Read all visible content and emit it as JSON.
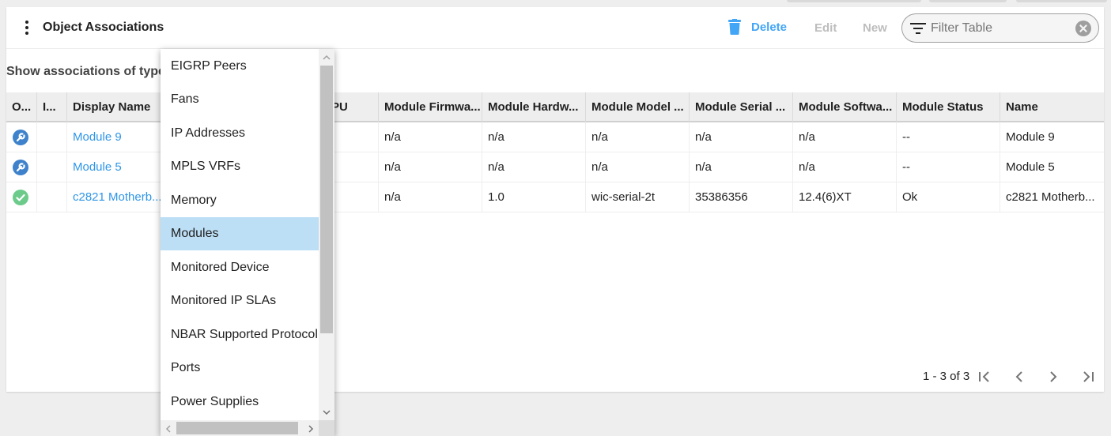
{
  "panel": {
    "title": "Object Associations"
  },
  "toolbar": {
    "delete_label": "Delete",
    "edit_label": "Edit",
    "new_label": "New",
    "filter_placeholder": "Filter Table"
  },
  "association": {
    "label": "Show associations of type:",
    "options": [
      "EIGRP Peers",
      "Fans",
      "IP Addresses",
      "MPLS VRFs",
      "Memory",
      "Modules",
      "Monitored Device",
      "Monitored IP SLAs",
      "NBAR Supported Protocol",
      "Ports",
      "Power Supplies"
    ],
    "selected": "Modules"
  },
  "table": {
    "columns": [
      "O...",
      "I...",
      "Display Name",
      "PU",
      "Module Firmwa...",
      "Module Hardw...",
      "Module Model ...",
      "Module Serial ...",
      "Module Softwa...",
      "Module Status",
      "Name"
    ],
    "rows": [
      {
        "status_icon": "wrench-icon",
        "display_name": "Module 9",
        "firmware": "n/a",
        "hardware": "n/a",
        "model": "n/a",
        "serial": "n/a",
        "software": "n/a",
        "status": "--",
        "name": "Module 9"
      },
      {
        "status_icon": "wrench-icon",
        "display_name": "Module 5",
        "firmware": "n/a",
        "hardware": "n/a",
        "model": "n/a",
        "serial": "n/a",
        "software": "n/a",
        "status": "--",
        "name": "Module 5"
      },
      {
        "status_icon": "check-icon",
        "display_name": "c2821 Motherb...",
        "firmware": "n/a",
        "hardware": "1.0",
        "model": "wic-serial-2t",
        "serial": "35386356",
        "software": "12.4(6)XT",
        "status": "Ok",
        "name": "c2821 Motherb..."
      }
    ]
  },
  "pagination": {
    "range_text": "1 - 3 of 3"
  },
  "colors": {
    "accent": "#42a5f5",
    "link": "#2f96e8",
    "wrench_status": "#3f82cc",
    "ok_status": "#6ccb8a",
    "selected_option": "#bcdff5"
  }
}
